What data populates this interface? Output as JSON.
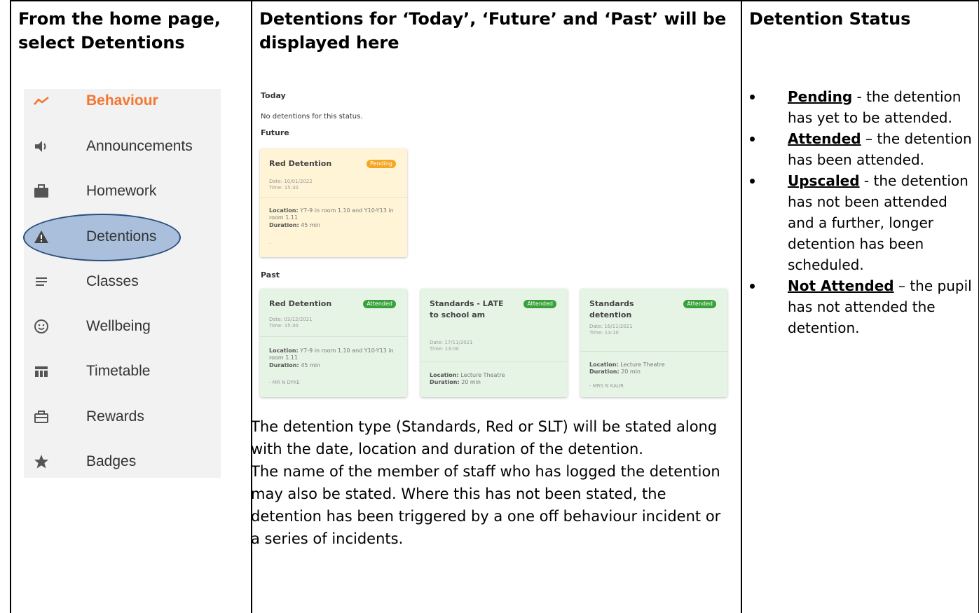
{
  "headings": {
    "col1": "From the home page, select Detentions",
    "col2": "Detentions for ‘Today’, ‘Future’ and ‘Past’ will be displayed here",
    "col3": "Detention Status"
  },
  "menu": {
    "items": [
      {
        "label": "Behaviour",
        "icon": "trend-line-icon",
        "active": true
      },
      {
        "label": "Announcements",
        "icon": "speaker-icon"
      },
      {
        "label": "Homework",
        "icon": "briefcase-icon"
      },
      {
        "label": "Detentions",
        "icon": "warning-triangle-icon"
      },
      {
        "label": "Classes",
        "icon": "lines-icon"
      },
      {
        "label": "Wellbeing",
        "icon": "smiley-icon"
      },
      {
        "label": "Timetable",
        "icon": "table-icon"
      },
      {
        "label": "Rewards",
        "icon": "toolbox-icon"
      },
      {
        "label": "Badges",
        "icon": "star-icon"
      }
    ],
    "accent_color": "#f47630"
  },
  "detentions": {
    "today_heading": "Today",
    "today_empty": "No detentions for this status.",
    "future_heading": "Future",
    "past_heading": "Past",
    "future": [
      {
        "title": "Red Detention",
        "status": "Pending",
        "date": "Date: 10/01/2022",
        "time": "Time: 15:30",
        "location_label": "Location:",
        "location": "Y7-9 in room 1.10 and Y10-Y13 in room 1.11",
        "duration_label": "Duration:",
        "duration": "45 min",
        "staff": "."
      }
    ],
    "past": [
      {
        "title": "Red Detention",
        "status": "Attended",
        "date": "Date: 03/12/2021",
        "time": "Time: 15:30",
        "location_label": "Location:",
        "location": "Y7-9 in room 1.10 and Y10-Y13 in room 1.11",
        "duration_label": "Duration:",
        "duration": "45 min",
        "staff": "- MR N DYKE"
      },
      {
        "title": "Standards - LATE to school am",
        "status": "Attended",
        "date": "Date: 17/11/2021",
        "time": "Time: 13:00",
        "location_label": "Location:",
        "location": "Lecture Theatre",
        "duration_label": "Duration:",
        "duration": "20 min",
        "staff": ""
      },
      {
        "title": "Standards detention",
        "status": "Attended",
        "date": "Date: 16/11/2021",
        "time": "Time: 13:10",
        "location_label": "Location:",
        "location": "Lecture Theatre",
        "duration_label": "Duration:",
        "duration": "20 min",
        "staff": "- MRS N KAUR"
      }
    ],
    "pending_color": "#f5a623",
    "attended_color": "#38a13a"
  },
  "description": {
    "line1": "The detention type (Standards, Red or SLT) will be stated along with the date, location and duration of the detention.",
    "line2": "The name of the member of staff who has logged the detention may also be stated. Where this has not been stated, the detention has been triggered by a one off behaviour incident or a series of incidents."
  },
  "statuses": [
    {
      "term": "Pending",
      "sep": " - ",
      "text": "the detention has yet to be attended."
    },
    {
      "term": "Attended",
      "sep": " – ",
      "text": "the detention has been attended."
    },
    {
      "term": "Upscaled",
      "sep": " - ",
      "text": "the detention has not been attended and a further, longer detention has been scheduled."
    },
    {
      "term": "Not Attended",
      "sep": " – ",
      "text": "the pupil has not attended the detention."
    }
  ]
}
